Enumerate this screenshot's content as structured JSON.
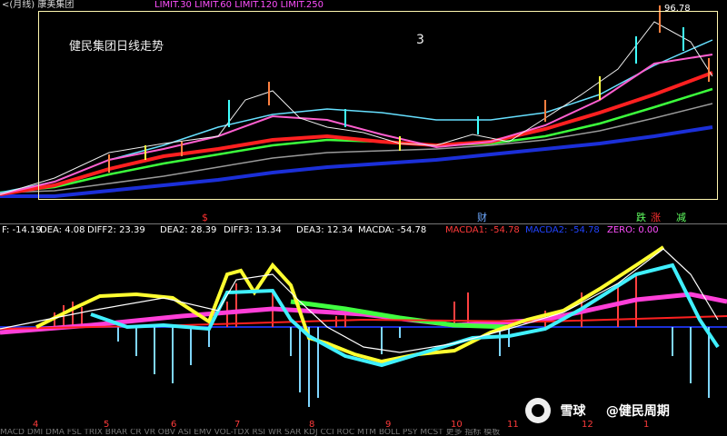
{
  "header": {
    "text_left": "<(月线) 康美集团",
    "text_mid": "LIMIT.30 LIMIT.60 LIMIT.120 LIMIT.250",
    "color_text": "#ff4fff"
  },
  "price_chart": {
    "title": "健民集团日线走势",
    "number": "3",
    "peak_value": "96.78",
    "events": [
      {
        "label": "$",
        "color": "#ff3030"
      },
      {
        "label": "财",
        "color": "#6ea9ff"
      },
      {
        "label": "跌",
        "color": "#60ff60"
      },
      {
        "label": "涨",
        "color": "#ff3030"
      },
      {
        "label": "减",
        "color": "#60ff60"
      }
    ]
  },
  "indicator_legend": {
    "items": [
      {
        "text": "F: -14.19",
        "color": "#ffffff"
      },
      {
        "text": "DEA: 4.08",
        "color": "#ffffff"
      },
      {
        "text": "DIFF2: 23.39",
        "color": "#ffffff"
      },
      {
        "text": "DEA2: 28.39",
        "color": "#ffffff"
      },
      {
        "text": "DIFF3: 13.34",
        "color": "#ffffff"
      },
      {
        "text": "DEA3: 12.34",
        "color": "#ffffff"
      },
      {
        "text": "MACDA: -54.78",
        "color": "#ffffff"
      },
      {
        "text": "MACDA1: -54.78",
        "color": "#ff3a3a"
      },
      {
        "text": "MACDA2: -54.78",
        "color": "#2244ff"
      },
      {
        "text": "ZERO: 0.00",
        "color": "#ff4fff"
      }
    ]
  },
  "x_axis": {
    "labels": [
      "4",
      "5",
      "6",
      "7",
      "8",
      "9",
      "10",
      "11",
      "12",
      "1"
    ],
    "color": "#ff3b3b"
  },
  "watermark": {
    "brand": "雪球",
    "user": "@健民周期"
  },
  "bottom_tools": "MACD DMI DMA FSL TRIX BRAR CR VR OBV ASI EMV VOL-TDX RSI WR SAR KDJ CCI ROC MTM BOLL PSY MCST 更多 指标 模板"
}
